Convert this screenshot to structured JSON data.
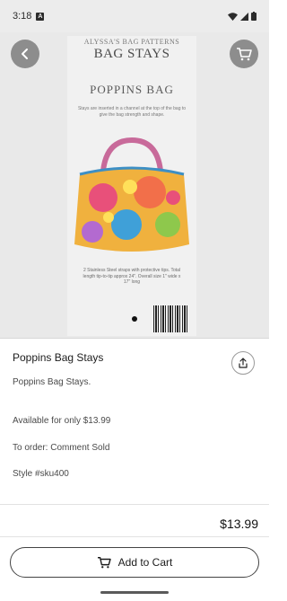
{
  "status_bar": {
    "time": "3:18",
    "notification": "A"
  },
  "hero": {
    "brand_line": "ALYSSA'S BAG PATTERNS",
    "brand_title": "BAG STAYS",
    "pattern_title": "POPPINS BAG",
    "pattern_description": "Stays are inserted in a channel at the top of the bag to give the bag strength and shape.",
    "package_note": "2 Stainless Steel straps with protective tips. Total length tip-to-tip approx 24\". Overall size 1\" wide x 17\" long",
    "image_count": 1,
    "active_image": 1
  },
  "product": {
    "title": "Poppins Bag Stays",
    "description": "Poppins Bag Stays.",
    "availability": "Available for only $13.99",
    "order_info": "To order: Comment Sold",
    "style": "Style #sku400",
    "price": "$13.99"
  },
  "actions": {
    "add_to_cart": "Add to Cart"
  },
  "icons": {
    "back": "chevron-left-icon",
    "cart": "cart-icon",
    "share": "share-icon"
  },
  "colors": {
    "overlay_button": "#8d8d8d",
    "background": "#ffffff"
  }
}
